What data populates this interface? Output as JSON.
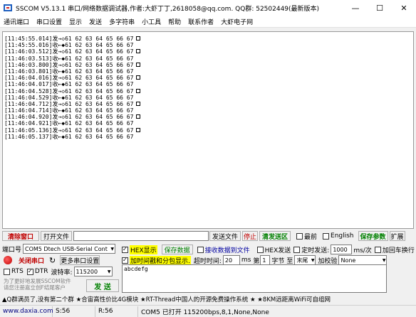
{
  "window": {
    "title": "SSCOM V5.13.1 串口/网络数据调试器,作者:大虾丁丁,2618058@qq.com. QQ群: 52502449(最新版本)"
  },
  "menu": [
    "通讯端口",
    "串口设置",
    "显示",
    "发送",
    "多字符串",
    "小工具",
    "帮助",
    "联系作者",
    "大虾电子网"
  ],
  "receive": {
    "lines": [
      {
        "ts": "[11:45:55.014]",
        "dir": "发→◇",
        "hex": "61 62 63 64 65 66 67"
      },
      {
        "ts": "[11:45:55.016]",
        "dir": "收←◆",
        "hex": "61 62 63 64 65 66 67"
      },
      {
        "ts": "[11:46:03.512]",
        "dir": "发→◇",
        "hex": "61 62 63 64 65 66 67"
      },
      {
        "ts": "[11:46:03.513]",
        "dir": "收←◆",
        "hex": "61 62 63 64 65 66 67"
      },
      {
        "ts": "[11:46:03.800]",
        "dir": "发→◇",
        "hex": "61 62 63 64 65 66 67"
      },
      {
        "ts": "[11:46:03.801]",
        "dir": "收←◆",
        "hex": "61 62 63 64 65 66 67"
      },
      {
        "ts": "[11:46:04.016]",
        "dir": "发→◇",
        "hex": "61 62 63 64 65 66 67"
      },
      {
        "ts": "[11:46:04.017]",
        "dir": "收←◆",
        "hex": "61 62 63 64 65 66 67"
      },
      {
        "ts": "[11:46:04.528]",
        "dir": "发→◇",
        "hex": "61 62 63 64 65 66 67"
      },
      {
        "ts": "[11:46:04.529]",
        "dir": "收←◆",
        "hex": "61 62 63 64 65 66 67"
      },
      {
        "ts": "[11:46:04.712]",
        "dir": "发→◇",
        "hex": "61 62 63 64 65 66 67"
      },
      {
        "ts": "[11:46:04.714]",
        "dir": "收←◆",
        "hex": "61 62 63 64 65 66 67"
      },
      {
        "ts": "[11:46:04.920]",
        "dir": "发→◇",
        "hex": "61 62 63 64 65 66 67"
      },
      {
        "ts": "[11:46:04.921]",
        "dir": "收←◆",
        "hex": "61 62 63 64 65 66 67"
      },
      {
        "ts": "[11:46:05.136]",
        "dir": "发→◇",
        "hex": "61 62 63 64 65 66 67"
      },
      {
        "ts": "[11:46:05.137]",
        "dir": "收←◆",
        "hex": "61 62 63 64 65 66 67"
      }
    ]
  },
  "toolbar": {
    "clear_window": "清除窗口",
    "open_file": "打开文件",
    "send_file": "发送文件",
    "stop": "停止",
    "clear_send": "清发送区",
    "topmost": "最前",
    "english": "English",
    "save_params": "保存参数",
    "expand": "扩展"
  },
  "port": {
    "label": "端口号",
    "value": "COM5 Dtech USB-Serial Cont",
    "close_port": "关闭串口",
    "more_settings": "更多串口设置",
    "rts": "RTS",
    "dtr": "DTR",
    "dtr_checked": true,
    "rts_checked": false,
    "baud_label": "波特率:",
    "baud_value": "115200",
    "promo": "为了更好地发展SSCOM软件\n请您注册嘉立创F结尾客户"
  },
  "options": {
    "hex_display": "HEX显示",
    "hex_display_checked": true,
    "save_data": "保存数据",
    "recv_to_file": "接收数据到文件",
    "hex_send": "HEX发送",
    "timed_send": "定时发送:",
    "period": "1000",
    "period_unit": "ms/次",
    "add_crlf": "加回车换行",
    "timestamp": "加时间戳和分包显示.",
    "timestamp_checked": true,
    "timeout_label": "超时时间:",
    "timeout_value": "20",
    "timeout_unit": "ms",
    "byte_pre": "第",
    "byte_value": "1",
    "byte_unit": "字节",
    "to_label": "至",
    "to_value": "末尾",
    "checksum_label": "加校验",
    "checksum_value": "None"
  },
  "send": {
    "text": "abcdefg",
    "button": "发  送"
  },
  "ticker": "▲Q群满员了,没有第二个群  ★合宙高性价比4G模块  ★RT-Thread中国人的开源免费操作系统  ★  ★8KM远距离WiFi可自组网",
  "status": {
    "site": "www.daxia.com",
    "s": "S:56",
    "r": "R:56",
    "port_state": "COM5 已打开  115200bps,8,1,None,None"
  }
}
